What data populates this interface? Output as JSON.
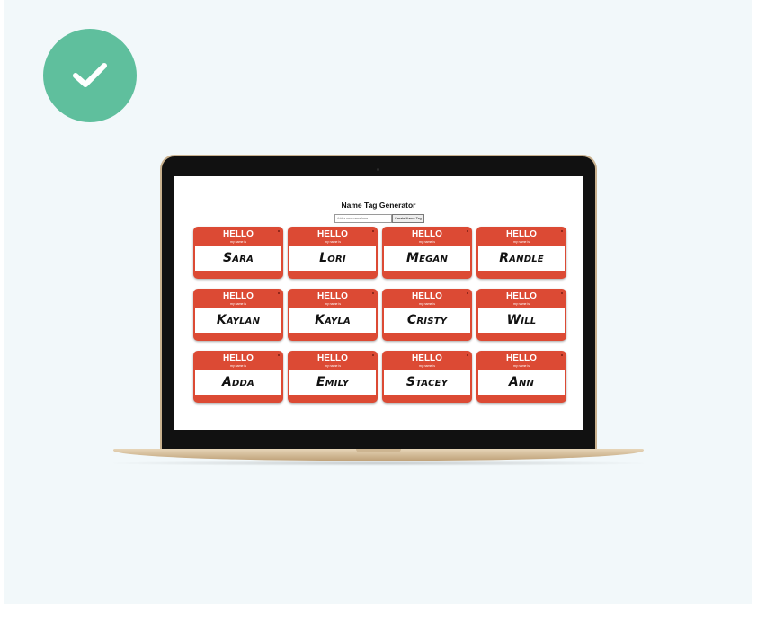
{
  "app": {
    "title": "Name Tag Generator",
    "input_placeholder": "Add a new name here...",
    "create_button_label": "Create Name Tag"
  },
  "tag_template": {
    "hello": "HELLO",
    "subtitle": "my name is"
  },
  "names": [
    "Sara",
    "Lori",
    "Megan",
    "Randle",
    "Kaylan",
    "Kayla",
    "Cristy",
    "Will",
    "Adda",
    "Emily",
    "Stacey",
    "Ann"
  ],
  "colors": {
    "tag_red": "#dc4a34",
    "check_green": "#5fbf9d",
    "background": "#f2f8fa"
  },
  "icons": {
    "status": "checkmark-icon"
  }
}
